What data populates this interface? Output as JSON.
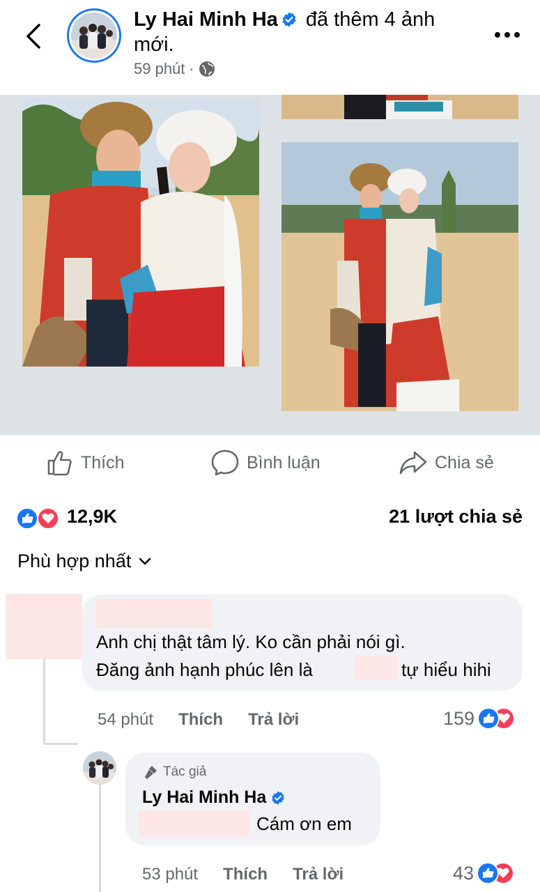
{
  "header": {
    "name": "Ly Hai Minh Ha",
    "action_text": "đã thêm 4 ảnh mới.",
    "time": "59 phút",
    "separator": "·",
    "audience_icon": "globe-icon"
  },
  "actions": {
    "like": "Thích",
    "comment": "Bình luận",
    "share": "Chia sẻ"
  },
  "stats": {
    "reactions": "12,9K",
    "shares": "21 lượt chia sẻ"
  },
  "sort": {
    "label": "Phù hợp nhất"
  },
  "comment": {
    "line1": "Anh chị thật tâm lý. Ko cần phải nói gì.",
    "line2a": "Đăng ảnh hạnh phúc lên là",
    "line2b": "tự hiểu hihi",
    "time": "54 phút",
    "like": "Thích",
    "reply": "Trả lời",
    "reactions": "159"
  },
  "reply": {
    "author_tag": "Tác giả",
    "name": "Ly Hai Minh Ha",
    "text": "Cám ơn em",
    "time": "53 phút",
    "like": "Thích",
    "reply": "Trả lời",
    "reactions": "43"
  },
  "colors": {
    "brand_blue": "#1877f2",
    "love_red": "#f33e58",
    "muted": "#65676b",
    "bubble": "#f0f2f5"
  }
}
